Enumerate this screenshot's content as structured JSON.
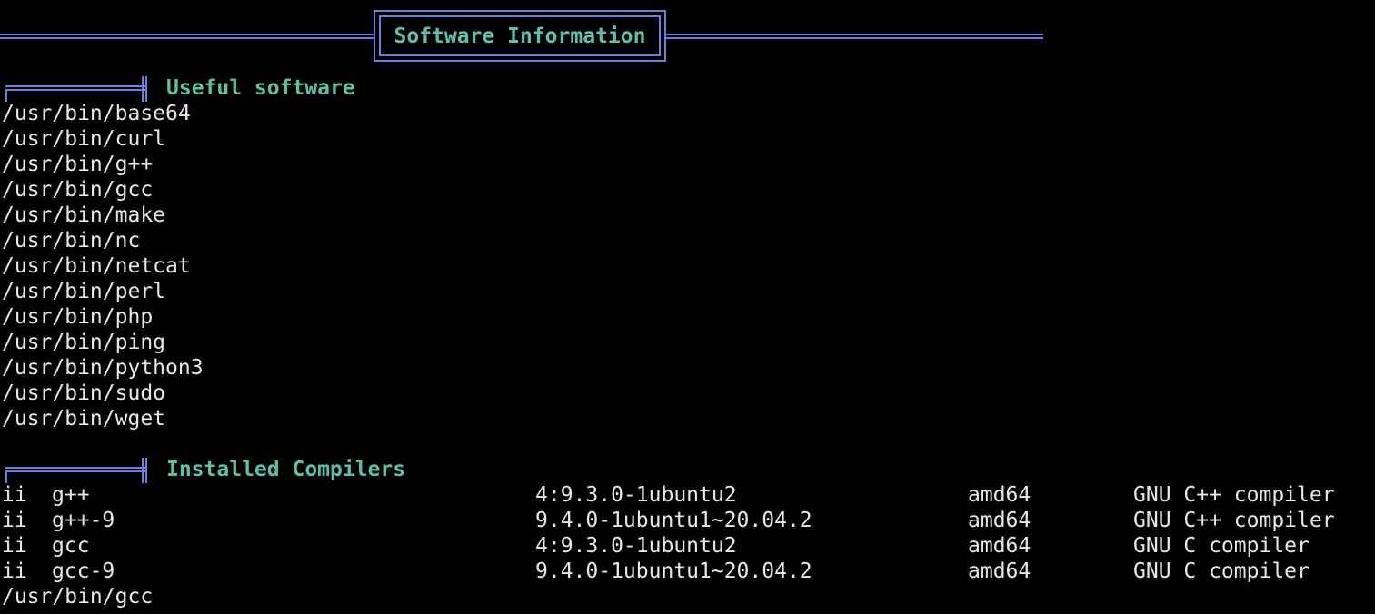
{
  "banner": {
    "title": "Software Information"
  },
  "useful_software": {
    "title": "Useful software",
    "items": [
      "/usr/bin/base64",
      "/usr/bin/curl",
      "/usr/bin/g++",
      "/usr/bin/gcc",
      "/usr/bin/make",
      "/usr/bin/nc",
      "/usr/bin/netcat",
      "/usr/bin/perl",
      "/usr/bin/php",
      "/usr/bin/ping",
      "/usr/bin/python3",
      "/usr/bin/sudo",
      "/usr/bin/wget"
    ]
  },
  "installed_compilers": {
    "title": "Installed Compilers",
    "rows": [
      {
        "status": "ii",
        "name": "g++",
        "version": "4:9.3.0-1ubuntu2",
        "arch": "amd64",
        "description": "GNU C++ compiler"
      },
      {
        "status": "ii",
        "name": "g++-9",
        "version": "9.4.0-1ubuntu1~20.04.2",
        "arch": "amd64",
        "description": "GNU C++ compiler"
      },
      {
        "status": "ii",
        "name": "gcc",
        "version": "4:9.3.0-1ubuntu2",
        "arch": "amd64",
        "description": "GNU C compiler"
      },
      {
        "status": "ii",
        "name": "gcc-9",
        "version": "9.4.0-1ubuntu1~20.04.2",
        "arch": "amd64",
        "description": "GNU C compiler"
      }
    ],
    "trailing_line": "/usr/bin/gcc"
  },
  "colors": {
    "background": "#000000",
    "text": "#e8e8e8",
    "accent": "#5fbfa8",
    "border": "#6b7fe0"
  }
}
